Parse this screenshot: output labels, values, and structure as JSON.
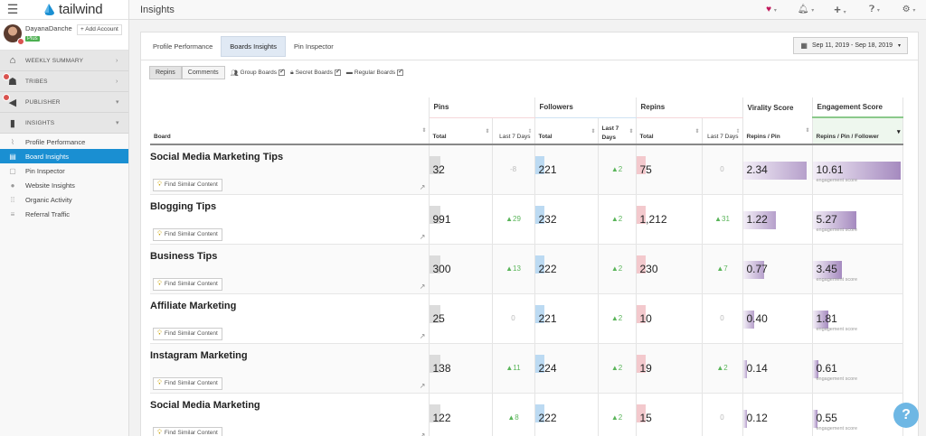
{
  "app": {
    "name": "tailwind"
  },
  "user": {
    "name": "DayanaDanchev",
    "plan": "Plus",
    "add_account": "Add Account"
  },
  "nav": {
    "sections": [
      {
        "label": "WEEKLY SUMMARY",
        "icon": "home-icon"
      },
      {
        "label": "TRIBES",
        "icon": "tribes-icon"
      },
      {
        "label": "PUBLISHER",
        "icon": "megaphone-icon"
      },
      {
        "label": "INSIGHTS",
        "icon": "bar-chart-icon"
      }
    ],
    "subitems": [
      {
        "label": "Profile Performance",
        "icon": "line-chart-icon"
      },
      {
        "label": "Board Insights",
        "icon": "board-icon"
      },
      {
        "label": "Pin Inspector",
        "icon": "pin-icon"
      },
      {
        "label": "Website Insights",
        "icon": "globe-icon"
      },
      {
        "label": "Organic Activity",
        "icon": "grid-icon"
      },
      {
        "label": "Referral Traffic",
        "icon": "referral-icon"
      }
    ]
  },
  "header": {
    "title": "Insights"
  },
  "tabs": [
    "Profile Performance",
    "Boards Insights",
    "Pin Inspector"
  ],
  "date_range": "Sep 11, 2019 - Sep 18, 2019",
  "filters": {
    "toggle": [
      "Repins",
      "Comments"
    ],
    "checks": [
      "Group Boards",
      "Secret Boards",
      "Regular Boards"
    ]
  },
  "table": {
    "board_header": "Board",
    "groups": [
      "Pins",
      "Followers",
      "Repins",
      "Virality Score",
      "Engagement Score"
    ],
    "subheaders": {
      "total": "Total",
      "last7": "Last 7 Days",
      "last7_split": "Last 7 Days",
      "repins_pin": "Repins / Pin",
      "eng": "Repins / Pin / Follower"
    },
    "find_label": "Find Similar Content",
    "eng_sub_label": "engagement score",
    "rows": [
      {
        "board": "Social Media Marketing Tips",
        "pins": "32",
        "pins_chg": "-8",
        "followers": "221",
        "fol_chg": "▲2",
        "repins": "75",
        "rep_chg": "0",
        "virality": "2.34",
        "engagement": "10.61",
        "eng_label": "engagement score"
      },
      {
        "board": "Blogging Tips",
        "pins": "991",
        "pins_chg": "▲29",
        "followers": "232",
        "fol_chg": "▲2",
        "repins": "1,212",
        "rep_chg": "▲31",
        "virality": "1.22",
        "engagement": "5.27",
        "eng_label": "engagement score"
      },
      {
        "board": "Business Tips",
        "pins": "300",
        "pins_chg": "▲13",
        "followers": "222",
        "fol_chg": "▲2",
        "repins": "230",
        "rep_chg": "▲7",
        "virality": "0.77",
        "engagement": "3.45",
        "eng_label": "engagement score"
      },
      {
        "board": "Affiliate Marketing",
        "pins": "25",
        "pins_chg": "0",
        "followers": "221",
        "fol_chg": "▲2",
        "repins": "10",
        "rep_chg": "0",
        "virality": "0.40",
        "engagement": "1.81",
        "eng_label": "engagement score"
      },
      {
        "board": "Instagram Marketing",
        "pins": "138",
        "pins_chg": "▲11",
        "followers": "224",
        "fol_chg": "▲2",
        "repins": "19",
        "rep_chg": "▲2",
        "virality": "0.14",
        "engagement": "0.61",
        "eng_label": "engagement score"
      },
      {
        "board": "Social Media Marketing",
        "pins": "122",
        "pins_chg": "▲8",
        "followers": "222",
        "fol_chg": "▲2",
        "repins": "15",
        "rep_chg": "0",
        "virality": "0.12",
        "engagement": "0.55",
        "eng_label": "engagement score"
      }
    ]
  },
  "help": "?"
}
